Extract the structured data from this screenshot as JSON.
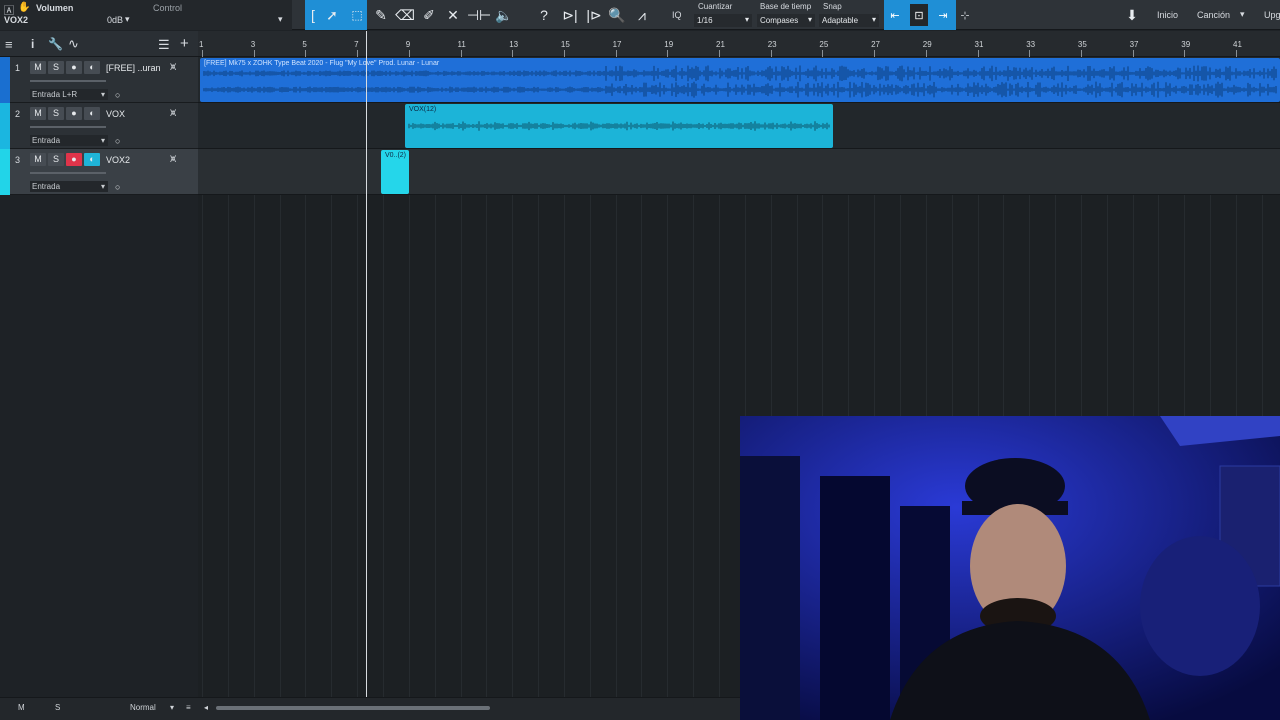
{
  "toolbar": {
    "volume_label": "Volumen",
    "control_label": "Control",
    "track_name": "VOX2",
    "volume_value": "0dB",
    "quantize_label": "Cuantizar",
    "quantize_value": "1/16",
    "timebase_label": "Base de tiemp",
    "timebase_value": "Compases",
    "snap_label": "Snap",
    "snap_value": "Adaptable",
    "iq_label": "IQ",
    "inicio_label": "Inicio",
    "cancion_label": "Canción",
    "upgrade_label": "Upg",
    "accent_color": "#1f8fd6"
  },
  "ruler": {
    "bars": [
      "1",
      "3",
      "5",
      "7",
      "9",
      "11",
      "13",
      "15",
      "17",
      "19",
      "21",
      "23",
      "25",
      "27",
      "29",
      "31",
      "33",
      "35",
      "37",
      "39",
      "41"
    ]
  },
  "tracks": [
    {
      "number": "1",
      "name": "[FREE] ..uran",
      "input": "Entrada L+R",
      "mute": "M",
      "solo": "S",
      "color": "#1a6fd0",
      "armed": false
    },
    {
      "number": "2",
      "name": "VOX",
      "input": "Entrada",
      "mute": "M",
      "solo": "S",
      "color": "#1bb6e0",
      "armed": false
    },
    {
      "number": "3",
      "name": "VOX2",
      "input": "Entrada",
      "mute": "M",
      "solo": "S",
      "color": "#22d4e8",
      "armed": true
    }
  ],
  "clips": [
    {
      "name": "[FREE] Mk75 x ZOHK Type Beat 2020 - Flug \"My Love\" Prod. Lunar - Lunar",
      "color": "#1f6fd8"
    },
    {
      "name": "VOX(12)",
      "color": "#1cb4d8"
    },
    {
      "name": "V0..(2)",
      "color": "#25d6ea"
    }
  ],
  "bottom": {
    "m_label": "M",
    "s_label": "S",
    "mode_label": "Normal"
  },
  "icons": [
    "hand-icon",
    "arrow-icon",
    "range-icon",
    "pencil-icon",
    "eraser-icon",
    "paint-icon",
    "mute-tool-icon",
    "split-icon",
    "speaker-icon",
    "help-icon",
    "listen-icon",
    "zoom-icon",
    "bend-icon",
    "list-icon",
    "info-icon",
    "wrench-icon",
    "automation-icon",
    "add-track-icon",
    "download-icon"
  ]
}
